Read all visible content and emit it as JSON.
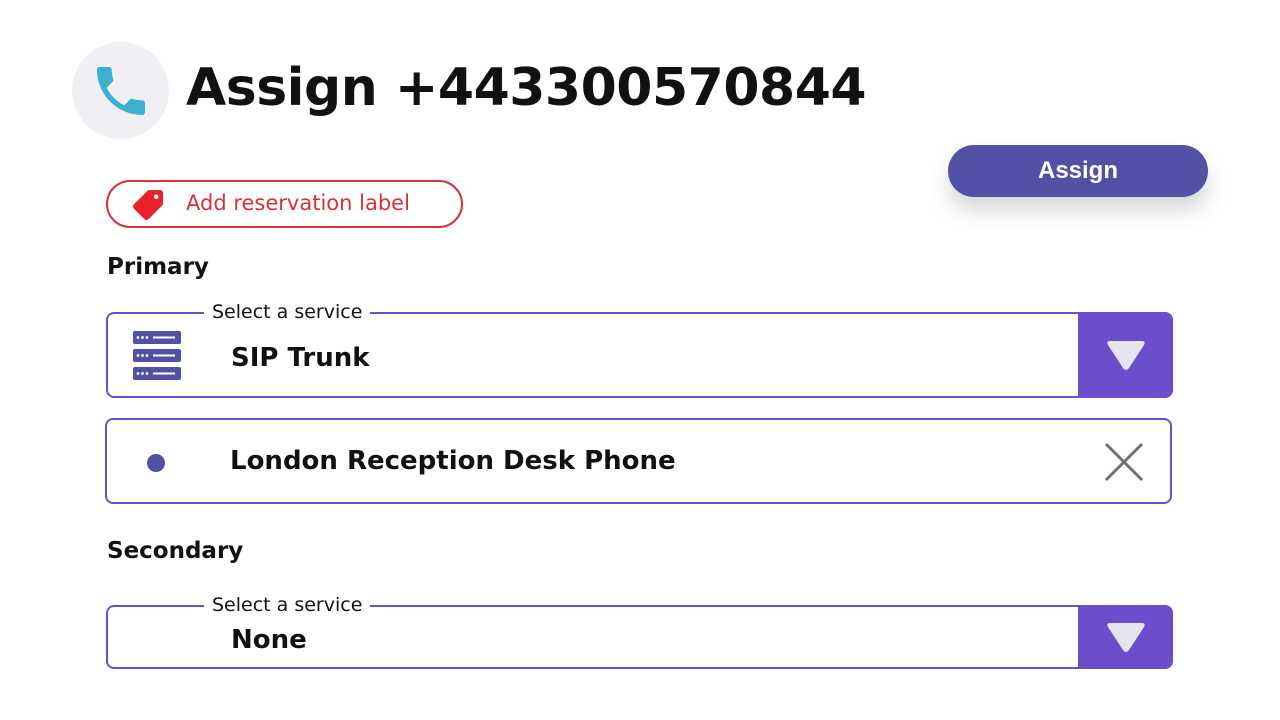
{
  "header": {
    "title": "Assign +443300570844",
    "icon": "phone-icon"
  },
  "toolbar": {
    "assign_label": "Assign"
  },
  "reservation_label": {
    "text": "Add reservation label",
    "icon": "tag-icon"
  },
  "primary": {
    "heading": "Primary",
    "select": {
      "legend": "Select a service",
      "value": "SIP Trunk",
      "icon": "server-icon"
    },
    "selected_item": {
      "label": "London Reception Desk Phone",
      "remove_icon": "close-icon"
    }
  },
  "secondary": {
    "heading": "Secondary",
    "select": {
      "legend": "Select a service",
      "value": "None"
    }
  },
  "colors": {
    "accent": "#6c4dcc",
    "button": "#5152a6",
    "danger": "#d9313a",
    "phone_icon": "#3bb0d1"
  }
}
